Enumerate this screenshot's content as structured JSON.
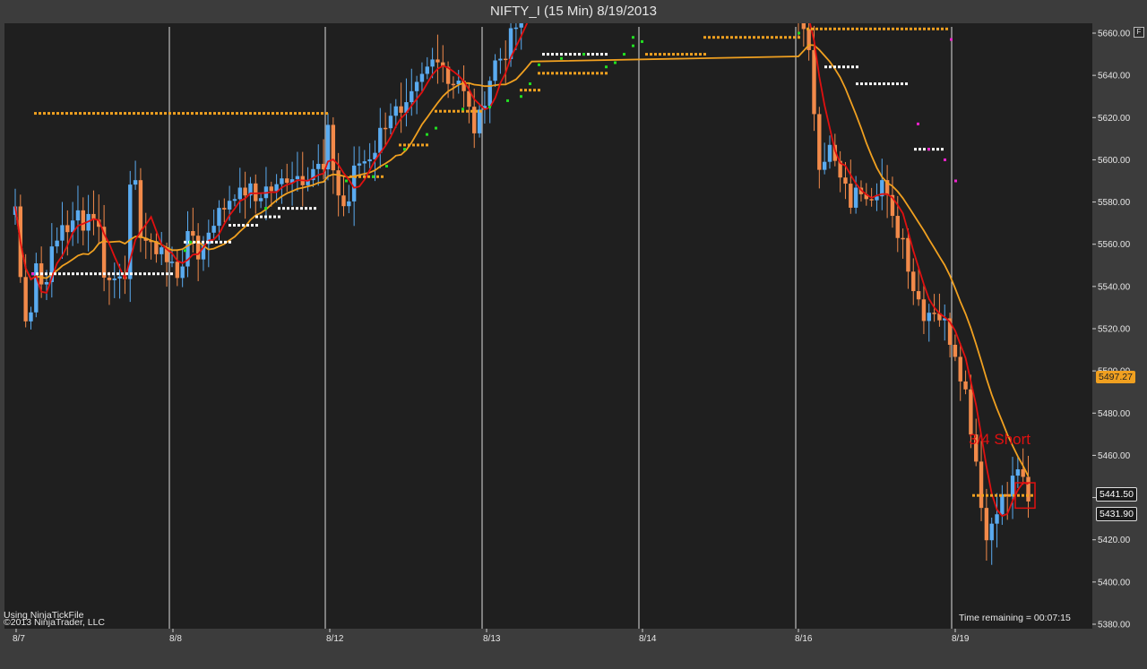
{
  "header": {
    "title": "NIFTY_I (15 Min)  8/19/2013",
    "f_button": "F"
  },
  "footer": {
    "source_line1": "Using NinjaTickFile",
    "source_line2": "©2013 NinjaTrader, LLC",
    "time_remaining": "Time remaining = 00:07:15"
  },
  "annotation": {
    "text": "3/4 Short",
    "color": "#e01010"
  },
  "price_tags": {
    "slow_ma": "5497.27",
    "last": "5441.50",
    "low": "5431.90"
  },
  "colors": {
    "background": "#1f1f1f",
    "frame": "#3c3c3c",
    "up_candle": "#5aabf0",
    "down_candle": "#f28a4a",
    "fast_ma": "#e01010",
    "slow_ma": "#f0a020",
    "dots_white": "#ffffff",
    "dots_orange": "#f0a020",
    "dots_green": "#22dd22",
    "dots_magenta": "#ee22cc"
  },
  "chart_data": {
    "type": "candlestick",
    "instrument": "NIFTY_I",
    "interval": "15 Min",
    "date": "8/19/2013",
    "ylim": [
      5380,
      5660
    ],
    "y_ticks": [
      5380,
      5400,
      5420,
      5440,
      5460,
      5480,
      5500,
      5520,
      5540,
      5560,
      5580,
      5600,
      5620,
      5640,
      5660
    ],
    "session_labels": [
      "8/7",
      "8/8",
      "8/12",
      "8/13",
      "8/14",
      "8/16",
      "8/19"
    ],
    "sessions": [
      {
        "label": "8/7",
        "key": [
          5578,
          5533,
          5522,
          5552,
          5538,
          5553,
          5560,
          5572,
          5565,
          5575,
          5570,
          5577,
          5570,
          5545,
          5541,
          5548,
          5548,
          5600,
          5568,
          5562,
          5555,
          5562,
          5551
        ]
      },
      {
        "label": "8/8",
        "key": [
          5550,
          5545,
          5560,
          5565,
          5553,
          5565,
          5572,
          5575,
          5580,
          5586,
          5582,
          5588,
          5580,
          5585,
          5587,
          5585,
          5590,
          5594,
          5593,
          5592,
          5596,
          5597,
          5594
        ]
      },
      {
        "label": "8/12",
        "key": [
          5612,
          5585,
          5575,
          5598,
          5600,
          5605,
          5617,
          5625,
          5618,
          5628,
          5637,
          5645,
          5652,
          5637,
          5640,
          5626,
          5612,
          5632,
          5646,
          5650,
          5660,
          5670,
          5680
        ]
      },
      {
        "label": "8/16",
        "key": [
          5670,
          5648,
          5600,
          5605,
          5590,
          5580,
          5587,
          5585,
          5590,
          5570,
          5563,
          5540,
          5528,
          5530,
          5522,
          5510,
          5490,
          5458,
          5420,
          5437,
          5441,
          5455,
          5436
        ]
      }
    ],
    "series": [
      {
        "name": "Fast MA",
        "color": "#e01010"
      },
      {
        "name": "Slow MA",
        "color": "#f0a020"
      }
    ],
    "current_price": 5441.5,
    "session_low": 5431.9,
    "slow_ma_value": 5497.27
  }
}
